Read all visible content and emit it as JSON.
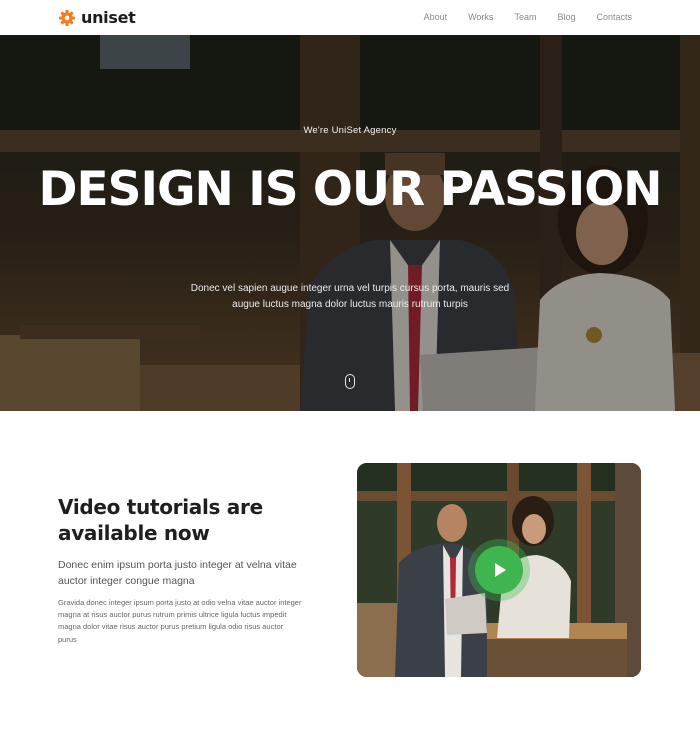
{
  "brand": {
    "name": "uniset",
    "accent": "#f47b20"
  },
  "nav": {
    "items": [
      {
        "label": "About"
      },
      {
        "label": "Works"
      },
      {
        "label": "Team"
      },
      {
        "label": "Blog"
      },
      {
        "label": "Contacts"
      }
    ]
  },
  "hero": {
    "kicker": "We're UniSet Agency",
    "title": "DESIGN IS OUR PASSION",
    "subtitle": "Donec vel sapien augue integer urna vel turpis cursus porta, mauris sed augue luctus magna dolor luctus mauris rutrum turpis",
    "scroll_icon": "mouse-scroll-icon"
  },
  "video": {
    "heading": "Video tutorials are available now",
    "lead": "Donec enim ipsum porta justo integer at velna vitae auctor integer congue magna",
    "body": "Gravida donec integer ipsum porta justo at odio velna vitae auctor integer magna at risus auctor purus rutrum primis ultrice ligula luctus impedit magna dolor vitae risus auctor purus pretium ligula odio risus auctor purus",
    "play_icon": "play-icon",
    "play_color": "#3fb54f"
  }
}
